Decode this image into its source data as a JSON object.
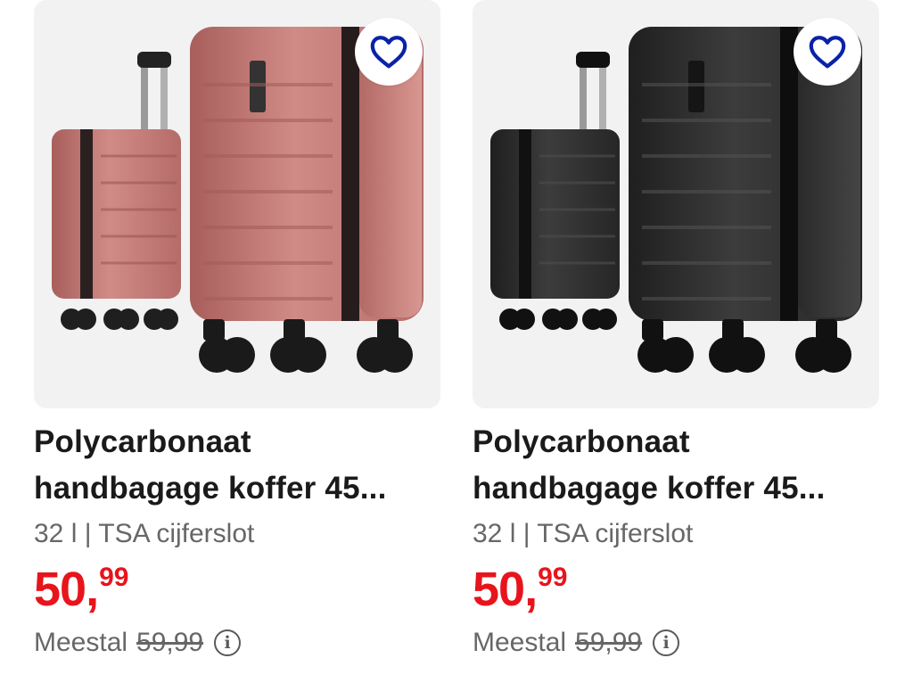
{
  "products": [
    {
      "title_line1": "Polycarbonaat",
      "title_line2": "handbagage koffer 45...",
      "specs": "32 l | TSA cijferslot",
      "price_main": "50,",
      "price_cents": "99",
      "was_label": "Meestal",
      "was_price": "59,99",
      "favorite_icon": "heart-outline-icon",
      "info_icon": "info-circle-icon",
      "color": "#c77a76"
    },
    {
      "title_line1": "Polycarbonaat",
      "title_line2": "handbagage koffer 45...",
      "specs": "32 l | TSA cijferslot",
      "price_main": "50,",
      "price_cents": "99",
      "was_label": "Meestal",
      "was_price": "59,99",
      "favorite_icon": "heart-outline-icon",
      "info_icon": "info-circle-icon",
      "color": "#2f2f2f"
    }
  ],
  "colors": {
    "price_red": "#e8141c",
    "heart_blue": "#0a22a8",
    "card_bg": "#f2f2f2"
  }
}
